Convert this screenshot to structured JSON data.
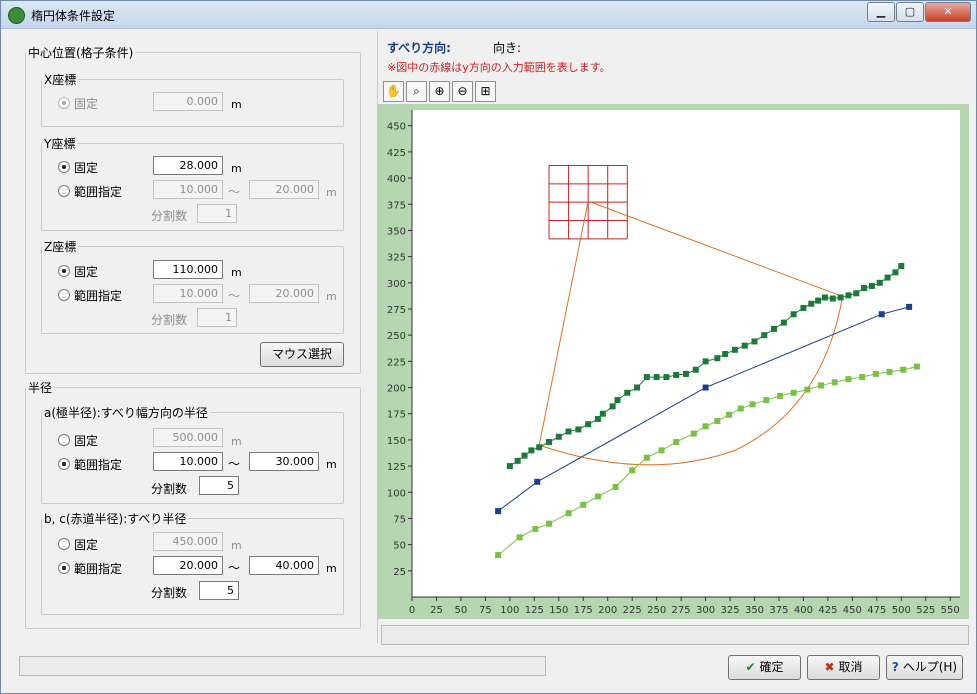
{
  "window": {
    "title": "楕円体条件設定",
    "min": "▁",
    "max": "▢",
    "close": "✕"
  },
  "center": {
    "legend": "中心位置(格子条件)",
    "x": {
      "legend": "X座標",
      "fixed_label": "固定",
      "fixed_value": "0.000",
      "unit": "m"
    },
    "y": {
      "legend": "Y座標",
      "fixed_label": "固定",
      "fixed_value": "28.000",
      "unit": "m",
      "range_label": "範囲指定",
      "range_from": "10.000",
      "tilde": "～",
      "range_to": "20.000",
      "range_unit": "m",
      "div_label": "分割数",
      "div_value": "1"
    },
    "z": {
      "legend": "Z座標",
      "fixed_label": "固定",
      "fixed_value": "110.000",
      "unit": "m",
      "range_label": "範囲指定",
      "range_from": "10.000",
      "tilde": "～",
      "range_to": "20.000",
      "range_unit": "m",
      "div_label": "分割数",
      "div_value": "1"
    },
    "mouse_button": "マウス選択"
  },
  "radius": {
    "legend": "半径",
    "a": {
      "legend": "a(極半径):すべり幅方向の半径",
      "fixed_label": "固定",
      "fixed_value": "500.000",
      "fixed_unit": "m",
      "range_label": "範囲指定",
      "range_from": "10.000",
      "tilde": "～",
      "range_to": "30.000",
      "range_unit": "m",
      "div_label": "分割数",
      "div_value": "5"
    },
    "bc": {
      "legend": "b, c(赤道半径):すべり半径",
      "fixed_label": "固定",
      "fixed_value": "450.000",
      "fixed_unit": "m",
      "range_label": "範囲指定",
      "range_from": "20.000",
      "tilde": "～",
      "range_to": "40.000",
      "range_unit": "m",
      "div_label": "分割数",
      "div_value": "5"
    }
  },
  "right": {
    "slip_dir_label": "すべり方向:",
    "orient_label": "向き:",
    "note": "※図中の赤線はy方向の入力範囲を表します。",
    "tools": [
      "hand-icon",
      "zoom-window-icon",
      "zoom-in-icon",
      "zoom-out-icon",
      "fit-icon"
    ]
  },
  "chart_data": {
    "type": "line",
    "x_ticks": [
      "0",
      "25",
      "50",
      "75",
      "100",
      "125",
      "150",
      "175",
      "200",
      "225",
      "250",
      "275",
      "300",
      "325",
      "350",
      "375",
      "400",
      "425",
      "450",
      "475",
      "500",
      "525",
      "550"
    ],
    "y_ticks": [
      "25",
      "50",
      "75",
      "100",
      "125",
      "150",
      "175",
      "200",
      "225",
      "250",
      "275",
      "300",
      "325",
      "350",
      "375",
      "400",
      "425",
      "450"
    ],
    "xlim": [
      0,
      560
    ],
    "ylim": [
      0,
      465
    ],
    "series": [
      {
        "color": "#1a7a3a",
        "values": [
          [
            100,
            125
          ],
          [
            108,
            130
          ],
          [
            115,
            135
          ],
          [
            122,
            140
          ],
          [
            130,
            143
          ],
          [
            140,
            148
          ],
          [
            150,
            153
          ],
          [
            160,
            158
          ],
          [
            170,
            160
          ],
          [
            180,
            165
          ],
          [
            190,
            170
          ],
          [
            195,
            175
          ],
          [
            205,
            182
          ],
          [
            210,
            188
          ],
          [
            220,
            195
          ],
          [
            230,
            200
          ],
          [
            240,
            210
          ],
          [
            250,
            210
          ],
          [
            260,
            210
          ],
          [
            270,
            212
          ],
          [
            280,
            213
          ],
          [
            290,
            217
          ],
          [
            300,
            225
          ],
          [
            312,
            228
          ],
          [
            320,
            232
          ],
          [
            330,
            236
          ],
          [
            340,
            240
          ],
          [
            350,
            244
          ],
          [
            360,
            250
          ],
          [
            370,
            256
          ],
          [
            380,
            262
          ],
          [
            390,
            270
          ],
          [
            400,
            276
          ],
          [
            408,
            280
          ],
          [
            415,
            283
          ],
          [
            422,
            286
          ],
          [
            430,
            285
          ],
          [
            438,
            286
          ],
          [
            446,
            288
          ],
          [
            454,
            290
          ],
          [
            462,
            295
          ],
          [
            470,
            297
          ],
          [
            478,
            300
          ],
          [
            486,
            305
          ],
          [
            494,
            310
          ],
          [
            500,
            316
          ]
        ]
      },
      {
        "color": "#1a3f8c",
        "values": [
          [
            88,
            82
          ],
          [
            128,
            110
          ],
          [
            300,
            200
          ],
          [
            480,
            270
          ],
          [
            508,
            277
          ]
        ]
      },
      {
        "color": "#7ac143",
        "values": [
          [
            88,
            40
          ],
          [
            110,
            57
          ],
          [
            126,
            65
          ],
          [
            140,
            70
          ],
          [
            160,
            80
          ],
          [
            175,
            88
          ],
          [
            190,
            96
          ],
          [
            208,
            105
          ],
          [
            225,
            121
          ],
          [
            240,
            133
          ],
          [
            255,
            140
          ],
          [
            270,
            148
          ],
          [
            288,
            156
          ],
          [
            300,
            163
          ],
          [
            312,
            168
          ],
          [
            324,
            174
          ],
          [
            336,
            180
          ],
          [
            348,
            184
          ],
          [
            362,
            188
          ],
          [
            376,
            192
          ],
          [
            390,
            195
          ],
          [
            404,
            198
          ],
          [
            418,
            202
          ],
          [
            432,
            205
          ],
          [
            446,
            208
          ],
          [
            460,
            210
          ],
          [
            474,
            213
          ],
          [
            488,
            215
          ],
          [
            502,
            217
          ],
          [
            516,
            220
          ]
        ]
      }
    ],
    "slip_circle_center": [
      180,
      378
    ],
    "grid_box": {
      "x": [
        140,
        220
      ],
      "y": [
        342,
        412
      ]
    }
  }
}
